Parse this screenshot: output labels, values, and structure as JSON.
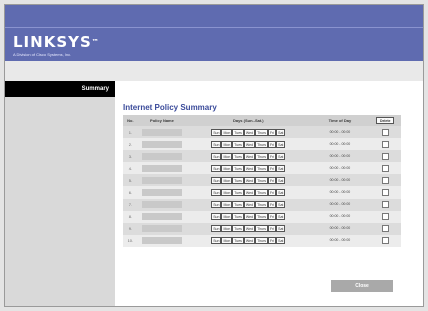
{
  "brand": {
    "logo": "LINKSYS",
    "tagline": "A Division of Cisco Systems, Inc."
  },
  "sidebar": {
    "title": "Summary"
  },
  "main": {
    "title": "Internet Policy Summary",
    "columns": {
      "no": "No.",
      "name": "Policy Name",
      "days": "Days (Sun.-Sat.)",
      "time": "Time of Day",
      "delete": "Delete"
    },
    "days": [
      "Sun",
      "Mon",
      "Tues",
      "Wed",
      "Thurs",
      "Fri",
      "Sat"
    ],
    "rows": [
      {
        "no": "1.",
        "time": "00:00 - 00:00"
      },
      {
        "no": "2.",
        "time": "00:00 - 00:00"
      },
      {
        "no": "3.",
        "time": "00:00 - 00:00"
      },
      {
        "no": "4.",
        "time": "00:00 - 00:00"
      },
      {
        "no": "5.",
        "time": "00:00 - 00:00"
      },
      {
        "no": "6.",
        "time": "00:00 - 00:00"
      },
      {
        "no": "7.",
        "time": "00:00 - 00:00"
      },
      {
        "no": "8.",
        "time": "00:00 - 00:00"
      },
      {
        "no": "9.",
        "time": "00:00 - 00:00"
      },
      {
        "no": "10.",
        "time": "00:00 - 00:00"
      }
    ],
    "close_label": "Close"
  }
}
